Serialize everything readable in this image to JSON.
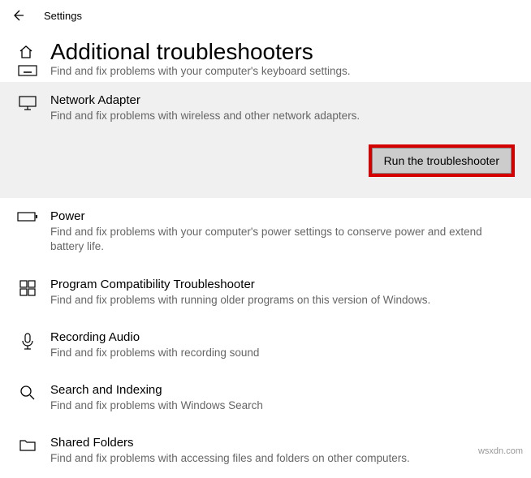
{
  "app": {
    "name": "Settings"
  },
  "page": {
    "title": "Additional troubleshooters",
    "keyboard_desc": "Find and fix problems with your computer's keyboard settings."
  },
  "items": {
    "network": {
      "title": "Network Adapter",
      "desc": "Find and fix problems with wireless and other network adapters.",
      "run_label": "Run the troubleshooter"
    },
    "power": {
      "title": "Power",
      "desc": "Find and fix problems with your computer's power settings to conserve power and extend battery life."
    },
    "compat": {
      "title": "Program Compatibility Troubleshooter",
      "desc": "Find and fix problems with running older programs on this version of Windows."
    },
    "recording": {
      "title": "Recording Audio",
      "desc": "Find and fix problems with recording sound"
    },
    "search": {
      "title": "Search and Indexing",
      "desc": "Find and fix problems with Windows Search"
    },
    "shared": {
      "title": "Shared Folders",
      "desc": "Find and fix problems with accessing files and folders on other computers."
    }
  },
  "watermark": "wsxdn.com"
}
